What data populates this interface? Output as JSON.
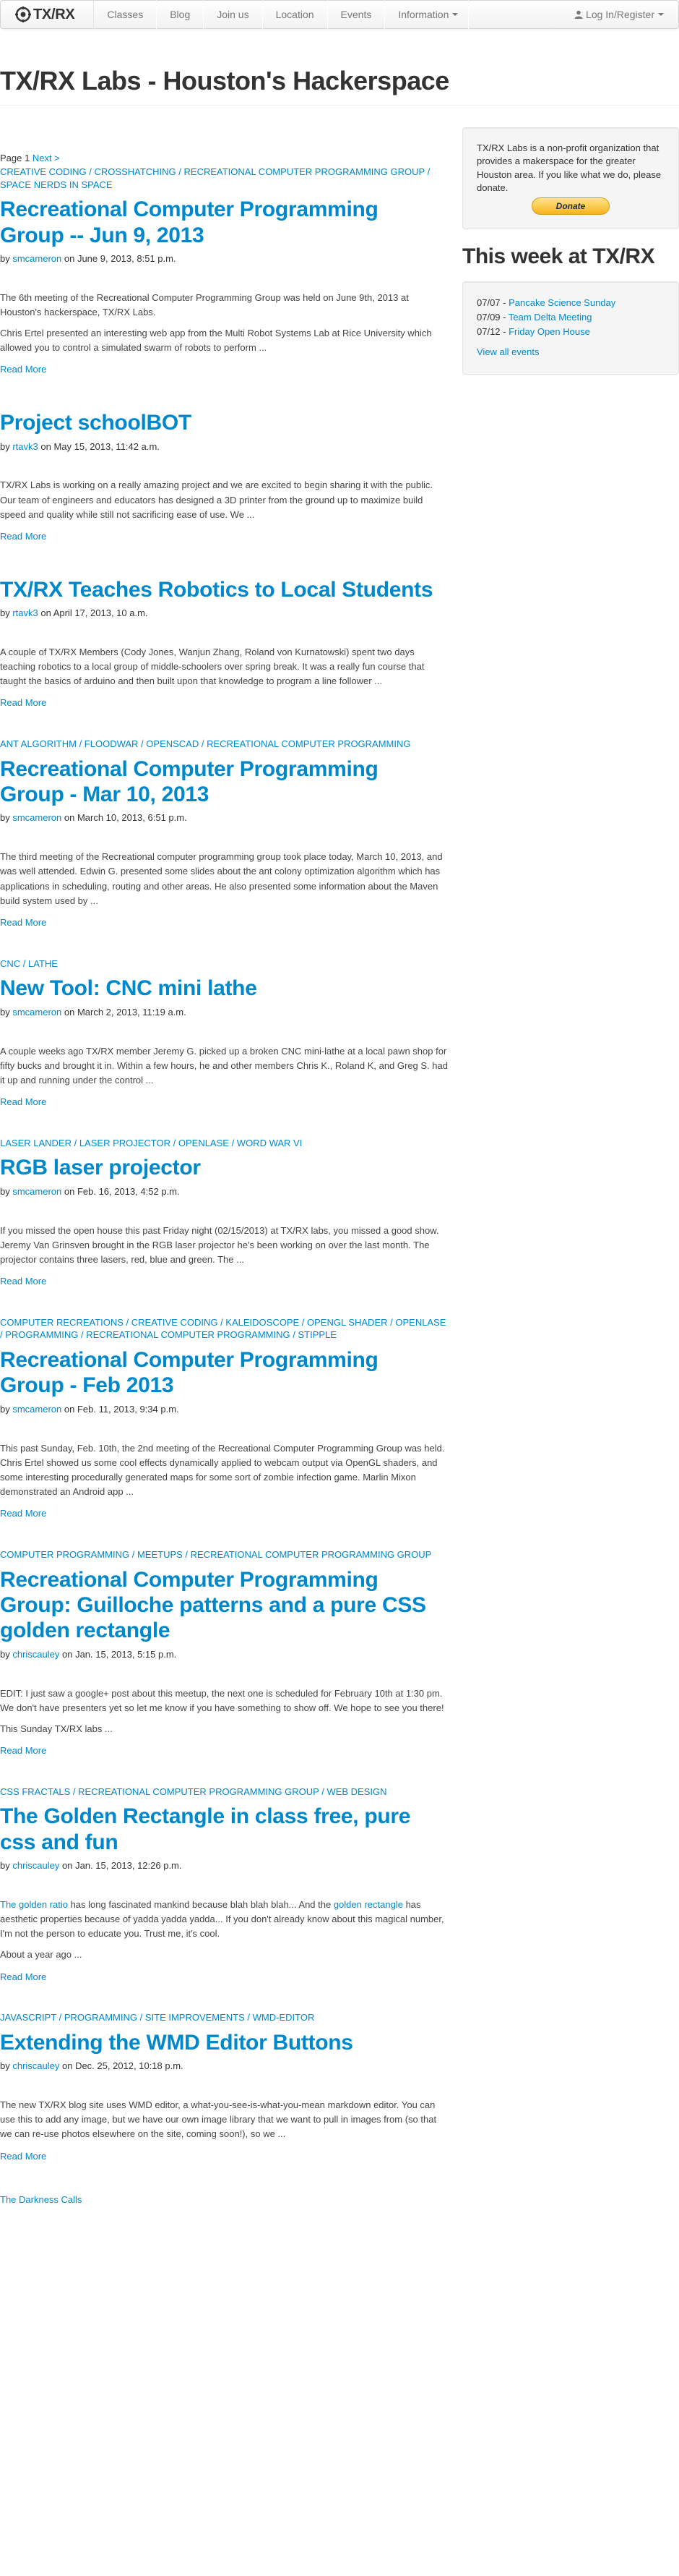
{
  "navbar": {
    "brand": "TX/RX",
    "items": [
      {
        "label": "Classes"
      },
      {
        "label": "Blog"
      },
      {
        "label": "Join us"
      },
      {
        "label": "Location"
      },
      {
        "label": "Events"
      }
    ],
    "information_label": "Information",
    "login_label": "Log In/Register"
  },
  "page": {
    "title": "TX/RX Labs - Houston's Hackerspace"
  },
  "pager": {
    "page_label": "Page 1",
    "next_label": "Next >"
  },
  "posts": [
    {
      "tags": [
        "CREATIVE CODING",
        "CROSSHATCHING",
        "RECREATIONAL COMPUTER PROGRAMMING GROUP",
        "SPACE NERDS IN SPACE"
      ],
      "title": "Recreational Computer Programming Group -- Jun 9, 2013",
      "author": "smcameron",
      "date": "June 9, 2013, 8:51 p.m.",
      "paragraphs": [
        "The 6th meeting of the Recreational Computer Programming Group was held on June 9th, 2013 at Houston's hackerspace, TX/RX Labs.",
        "Chris Ertel presented an interesting web app from the Multi Robot Systems Lab at Rice University which allowed you to control a simulated swarm of robots to perform ..."
      ],
      "read_more": "Read More"
    },
    {
      "tags": [],
      "title": "Project schoolBOT",
      "author": "rtavk3",
      "date": "May 15, 2013, 11:42 a.m.",
      "paragraphs": [
        "TX/RX Labs is working on a really amazing project and we are excited to begin sharing it with the public. Our team of engineers and educators has designed a 3D printer from the ground up to maximize build speed and quality while still not sacrificing ease of use. We ..."
      ],
      "read_more": "Read More"
    },
    {
      "tags": [],
      "title": "TX/RX Teaches Robotics to Local Students",
      "author": "rtavk3",
      "date": "April 17, 2013, 10 a.m.",
      "paragraphs": [
        "A couple of TX/RX Members (Cody Jones, Wanjun Zhang, Roland von Kurnatowski) spent two days teaching robotics to a local group of middle-schoolers over spring break. It was a really fun course that taught the basics of arduino and then built upon that knowledge to program a line follower ..."
      ],
      "read_more": "Read More"
    },
    {
      "tags": [
        "ANT ALGORITHM",
        "FLOODWAR",
        "OPENSCAD",
        "RECREATIONAL COMPUTER PROGRAMMING"
      ],
      "title": "Recreational Computer Programming Group - Mar 10, 2013",
      "author": "smcameron",
      "date": "March 10, 2013, 6:51 p.m.",
      "paragraphs": [
        "The third meeting of the Recreational computer programming group took place today, March 10, 2013, and was well attended. Edwin G. presented some slides about the ant colony optimization algorithm which has applications in scheduling, routing and other areas. He also presented some information about the Maven build system used by ..."
      ],
      "read_more": "Read More"
    },
    {
      "tags": [
        "CNC",
        "LATHE"
      ],
      "title": "New Tool: CNC mini lathe",
      "author": "smcameron",
      "date": "March 2, 2013, 11:19 a.m.",
      "paragraphs": [
        "A couple weeks ago TX/RX member Jeremy G. picked up a broken CNC mini-lathe at a local pawn shop for fifty bucks and brought it in. Within a few hours, he and other members Chris K., Roland K, and Greg S. had it up and running under the control ..."
      ],
      "read_more": "Read More"
    },
    {
      "tags": [
        "LASER LANDER",
        "LASER PROJECTOR",
        "OPENLASE",
        "WORD WAR VI"
      ],
      "title": "RGB laser projector",
      "author": "smcameron",
      "date": "Feb. 16, 2013, 4:52 p.m.",
      "paragraphs": [
        "If you missed the open house this past Friday night (02/15/2013) at TX/RX labs, you missed a good show. Jeremy Van Grinsven brought in the RGB laser projector he's been working on over the last month. The projector contains three lasers, red, blue and green. The ..."
      ],
      "read_more": "Read More"
    },
    {
      "tags": [
        "COMPUTER RECREATIONS",
        "CREATIVE CODING",
        "KALEIDOSCOPE",
        "OPENGL SHADER",
        "OPENLASE",
        "PROGRAMMING",
        "RECREATIONAL COMPUTER PROGRAMMING",
        "STIPPLE"
      ],
      "title": "Recreational Computer Programming Group - Feb 2013",
      "author": "smcameron",
      "date": "Feb. 11, 2013, 9:34 p.m.",
      "paragraphs": [
        "This past Sunday, Feb. 10th, the 2nd meeting of the Recreational Computer Programming Group was held. Chris Ertel showed us some cool effects dynamically applied to webcam output via OpenGL shaders, and some interesting procedurally generated maps for some sort of zombie infection game. Marlin Mixon demonstrated an Android app ..."
      ],
      "read_more": "Read More"
    },
    {
      "tags": [
        "COMPUTER PROGRAMMING",
        "MEETUPS",
        "RECREATIONAL COMPUTER PROGRAMMING GROUP"
      ],
      "title": "Recreational Computer Programming Group: Guilloche patterns and a pure CSS golden rectangle",
      "author": "chriscauley",
      "date": "Jan. 15, 2013, 5:15 p.m.",
      "paragraphs": [
        "EDIT: I just saw a google+ post about this meetup, the next one is scheduled for February 10th at 1:30 pm. We don't have presenters yet so let me know if you have something to show off. We hope to see you there!",
        "This Sunday TX/RX labs ..."
      ],
      "read_more": "Read More"
    },
    {
      "tags": [
        "CSS FRACTALS",
        "RECREATIONAL COMPUTER PROGRAMMING GROUP",
        "WEB DESIGN"
      ],
      "title": "The Golden Rectangle in class free, pure css and fun",
      "author": "chriscauley",
      "date": "Jan. 15, 2013, 12:26 p.m.",
      "rich": {
        "p1_link1": "The golden ratio",
        "p1_text1": " has long fascinated mankind because blah blah blah... And the ",
        "p1_link2": "golden rectangle",
        "p1_text2": " has aesthetic properties because of yadda yadda yadda... If you don't already know about this magical number, I'm not the person to educate you. Trust me, it's cool.",
        "p2": "About a year ago ..."
      },
      "read_more": "Read More"
    },
    {
      "tags": [
        "JAVASCRIPT",
        "PROGRAMMING",
        "SITE IMPROVEMENTS",
        "WMD-EDITOR"
      ],
      "title": "Extending the WMD Editor Buttons",
      "author": "chriscauley",
      "date": "Dec. 25, 2012, 10:18 p.m.",
      "paragraphs": [
        "The new TX/RX blog site uses WMD editor, a what-you-see-is-what-you-mean markdown editor. You can use this to add any image, but we have our own image library that we want to pull in images from (so that we can re-use photos elsewhere on the site, coming soon!), so we ..."
      ],
      "read_more": "Read More"
    }
  ],
  "footer_link": "The Darkness Calls",
  "sidebar": {
    "about_text": "TX/RX Labs is a non-profit organization that provides a makerspace for the greater Houston area. If you like what we do, please donate.",
    "donate_label": "Donate",
    "week_title": "This week at TX/RX",
    "events": [
      {
        "date": "07/07",
        "name": "Pancake Science Sunday"
      },
      {
        "date": "07/09",
        "name": "Team Delta Meeting"
      },
      {
        "date": "07/12",
        "name": "Friday Open House"
      }
    ],
    "view_all_label": "View all events"
  },
  "colors": {
    "link": "#0088cc",
    "text": "#333333",
    "donate": "#f7b31c"
  }
}
